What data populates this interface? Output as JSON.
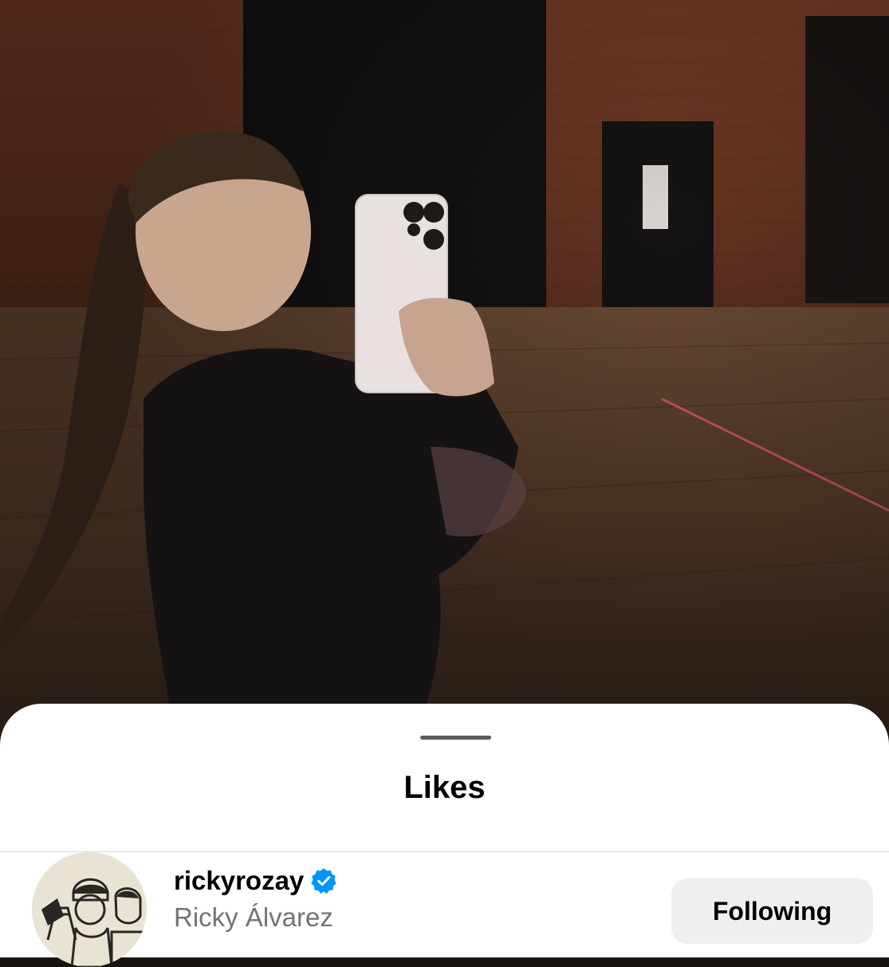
{
  "sheet": {
    "title": "Likes"
  },
  "likes": [
    {
      "username": "rickyrozay",
      "full_name": "Ricky Álvarez",
      "verified": true,
      "follow_button_label": "Following"
    }
  ],
  "colors": {
    "verified_badge": "#0095f6",
    "follow_button_bg": "#efeff1",
    "secondary_text": "#737373"
  },
  "icons": {
    "verified": "verified-badge-icon"
  }
}
